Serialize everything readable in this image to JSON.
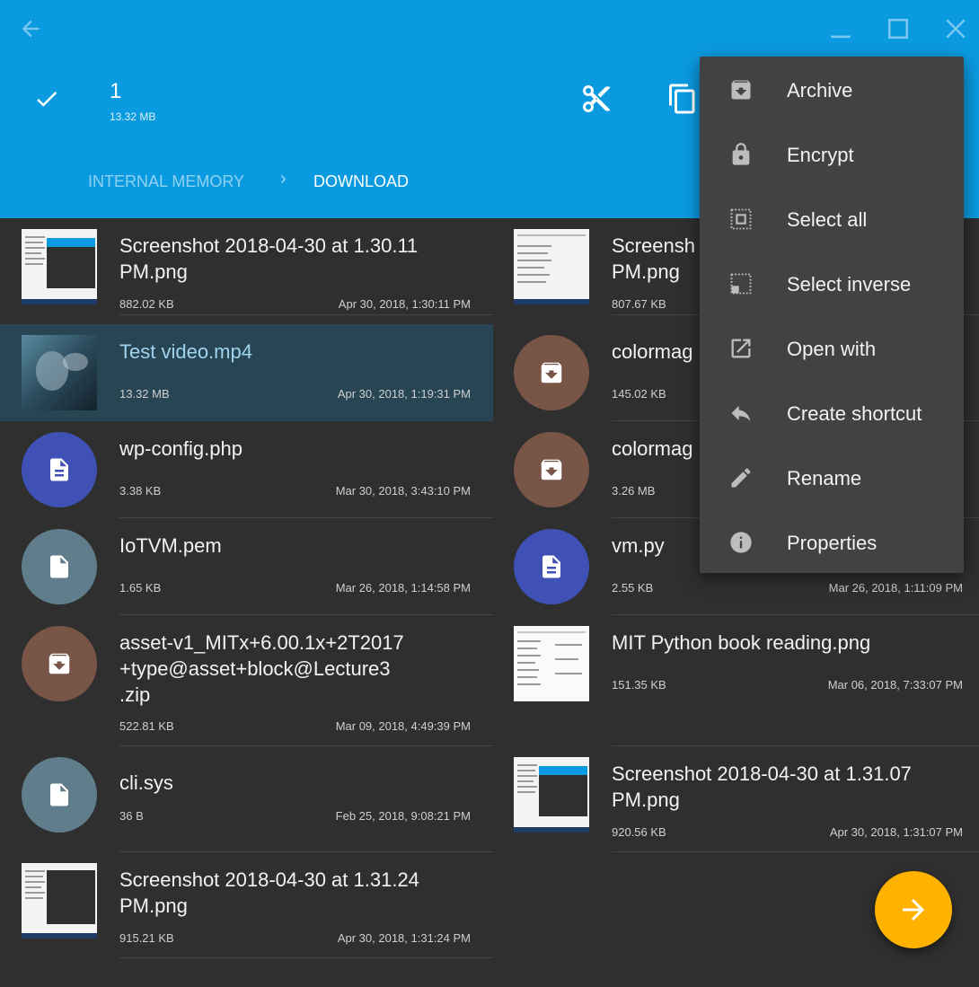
{
  "selection": {
    "count": "1",
    "size": "13.32 MB"
  },
  "breadcrumb": {
    "root": "INTERNAL MEMORY",
    "separator": "›",
    "current": "DOWNLOAD"
  },
  "colors": {
    "header": "#0a9ae0",
    "background": "#2f2f2f",
    "menu": "#424242",
    "fab": "#ffb300",
    "selected": "#274553"
  },
  "files_left": [
    {
      "name": "Screenshot 2018-04-30 at 1.30.11\nPM.png",
      "size": "882.02 KB",
      "date": "Apr 30, 2018, 1:30:11 PM",
      "icon": "image-thumbnail"
    },
    {
      "name": "Test video.mp4",
      "size": "13.32 MB",
      "date": "Apr 30, 2018, 1:19:31 PM",
      "icon": "video-thumbnail"
    },
    {
      "name": "wp-config.php",
      "size": "3.38 KB",
      "date": "Mar 30, 2018, 3:43:10 PM",
      "icon": "document-icon"
    },
    {
      "name": "IoTVM.pem",
      "size": "1.65 KB",
      "date": "Mar 26, 2018, 1:14:58 PM",
      "icon": "file-icon"
    },
    {
      "name": "asset-v1_MITx+6.00.1x+2T2017\n+type@asset+block@Lecture3\n.zip",
      "size": "522.81 KB",
      "date": "Mar 09, 2018, 4:49:39 PM",
      "icon": "archive-icon"
    },
    {
      "name": "cli.sys",
      "size": "36 B",
      "date": "Feb 25, 2018, 9:08:21 PM",
      "icon": "file-icon"
    },
    {
      "name": "Screenshot 2018-04-30 at 1.31.24\nPM.png",
      "size": "915.21 KB",
      "date": "Apr 30, 2018, 1:31:24 PM",
      "icon": "image-thumbnail"
    }
  ],
  "files_right": [
    {
      "name": "Screensh\nPM.png",
      "size": "807.67 KB",
      "icon": "image-thumbnail"
    },
    {
      "name": "colormag",
      "size": "145.02 KB",
      "icon": "archive-icon"
    },
    {
      "name": "colormag",
      "size": "3.26 MB",
      "icon": "archive-icon"
    },
    {
      "name": "vm.py",
      "size": "2.55 KB",
      "date": "Mar 26, 2018, 1:11:09 PM",
      "icon": "document-icon"
    },
    {
      "name": "MIT Python book reading.png",
      "size": "151.35 KB",
      "date": "Mar 06, 2018, 7:33:07 PM",
      "icon": "image-thumbnail"
    },
    {
      "name": "Screenshot 2018-04-30 at 1.31.07\nPM.png",
      "size": "920.56 KB",
      "date": "Apr 30, 2018, 1:31:07 PM",
      "icon": "image-thumbnail"
    }
  ],
  "menu": [
    {
      "label": "Archive",
      "icon": "archive-icon"
    },
    {
      "label": "Encrypt",
      "icon": "lock-icon"
    },
    {
      "label": "Select all",
      "icon": "select-all-icon"
    },
    {
      "label": "Select inverse",
      "icon": "select-inverse-icon"
    },
    {
      "label": "Open with",
      "icon": "open-external-icon"
    },
    {
      "label": "Create shortcut",
      "icon": "reply-icon"
    },
    {
      "label": "Rename",
      "icon": "pencil-icon"
    },
    {
      "label": "Properties",
      "icon": "info-icon"
    }
  ]
}
